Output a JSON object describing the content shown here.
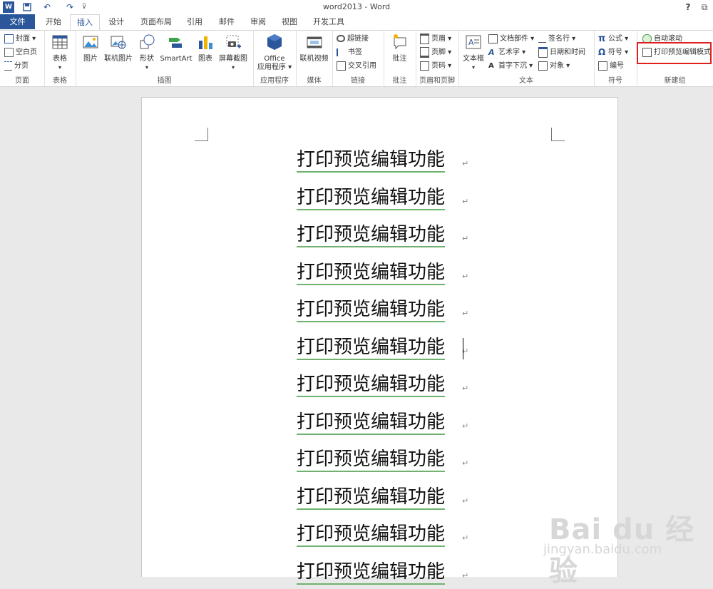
{
  "window": {
    "title": "word2013 - Word",
    "help": "?",
    "restore": "⧉"
  },
  "quick_access": {
    "save": "💾",
    "undo": "↶",
    "redo": "↷",
    "more": "⊽"
  },
  "tabs": [
    {
      "label": "文件"
    },
    {
      "label": "开始"
    },
    {
      "label": "插入"
    },
    {
      "label": "设计"
    },
    {
      "label": "页面布局"
    },
    {
      "label": "引用"
    },
    {
      "label": "邮件"
    },
    {
      "label": "审阅"
    },
    {
      "label": "视图"
    },
    {
      "label": "开发工具"
    }
  ],
  "ribbon": {
    "page": {
      "label": "页面",
      "cover": "封面 ▾",
      "blank": "空白页",
      "break": "分页"
    },
    "table": {
      "label": "表格",
      "btn": "表格"
    },
    "illus": {
      "label": "插图",
      "picture": "图片",
      "online_picture": "联机图片",
      "shapes": "形状",
      "smartart": "SmartArt",
      "chart": "图表",
      "screenshot": "屏幕截图"
    },
    "apps": {
      "label": "应用程序",
      "office": "Office",
      "office2": "应用程序 ▾"
    },
    "media": {
      "label": "媒体",
      "video": "联机视频"
    },
    "links": {
      "label": "链接",
      "hyperlink": "超链接",
      "bookmark": "书签",
      "crossref": "交叉引用"
    },
    "comments": {
      "label": "批注",
      "comment": "批注"
    },
    "hf": {
      "label": "页眉和页脚",
      "header": "页眉 ▾",
      "footer": "页脚 ▾",
      "pagenum": "页码 ▾"
    },
    "text": {
      "label": "文本",
      "textbox": "文本框",
      "docparts": "文档部件 ▾",
      "wordart": "艺术字 ▾",
      "dropcap": "首字下沉 ▾",
      "sigline": "签名行 ▾",
      "datetime": "日期和时间",
      "object": "对象 ▾"
    },
    "symbols": {
      "label": "符号",
      "equation": "公式 ▾",
      "symbol": "符号 ▾",
      "number": "编号"
    },
    "newgroup": {
      "label": "新建组",
      "autoscroll": "自动滚动",
      "printedit": "打印预览编辑模式"
    }
  },
  "document": {
    "lines": [
      "打印预览编辑功能",
      "打印预览编辑功能",
      "打印预览编辑功能",
      "打印预览编辑功能",
      "打印预览编辑功能",
      "打印预览编辑功能",
      "打印预览编辑功能",
      "打印预览编辑功能",
      "打印预览编辑功能",
      "打印预览编辑功能",
      "打印预览编辑功能",
      "打印预览编辑功能"
    ],
    "para_mark": "↵"
  },
  "watermark": {
    "logo": "Bai du 经验",
    "url": "jingyan.baidu.com"
  },
  "colors": {
    "accent": "#2b579a",
    "highlight_box": "#e02020",
    "underline": "#6fb26f"
  }
}
